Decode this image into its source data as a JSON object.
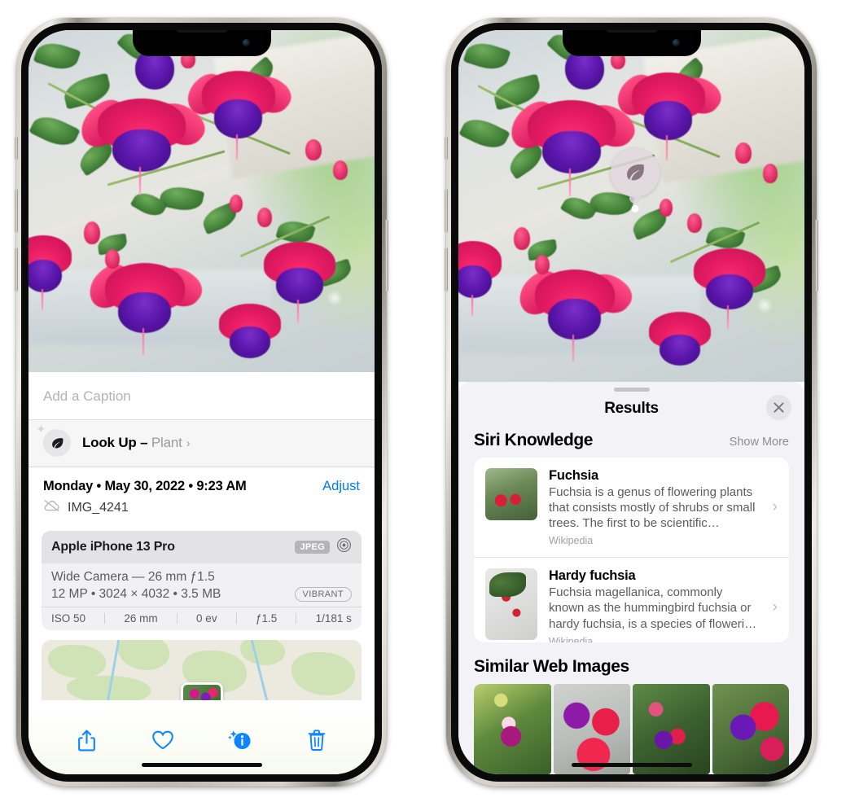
{
  "left_phone": {
    "name": "iPhone photo detail view",
    "photo": {
      "alt": "Fuchsia flowers hanging basket",
      "icon": "photo-icon"
    },
    "caption_field": {
      "placeholder": "Add a Caption",
      "value": ""
    },
    "lookup": {
      "icon": "leaf-icon",
      "sparkle_icon": "sparkle-icon",
      "label": "Look Up – ",
      "subject": "Plant",
      "chevron": "›"
    },
    "meta": {
      "date": "Monday • May 30, 2022 • 9:23 AM",
      "adjust_label": "Adjust",
      "cloud_icon": "cloud-slash-icon",
      "filename": "IMG_4241"
    },
    "camera_card": {
      "device": "Apple iPhone 13 Pro",
      "format_chip": "JPEG",
      "aperture_icon": "aperture-icon",
      "lens_line": "Wide Camera — 26 mm ƒ1.5",
      "specs_line": "12 MP • 3024 × 4032 • 3.5 MB",
      "style_chip": "VIBRANT",
      "exif": [
        "ISO 50",
        "26 mm",
        "0 ev",
        "ƒ1.5",
        "1/181 s"
      ]
    },
    "map": {
      "name": "location-map",
      "pin_label": ""
    },
    "toolbar": [
      {
        "name": "share-button",
        "icon": "share-icon"
      },
      {
        "name": "favorite-button",
        "icon": "heart-icon"
      },
      {
        "name": "info-button",
        "icon": "info-sparkle-icon"
      },
      {
        "name": "delete-button",
        "icon": "trash-icon"
      }
    ]
  },
  "right_phone": {
    "name": "Visual Look Up results view",
    "marker": {
      "icon": "leaf-icon",
      "label": ""
    },
    "sheet": {
      "grabber": "",
      "title": "Results",
      "close_icon": "close-icon"
    },
    "siri_knowledge": {
      "title": "Siri Knowledge",
      "show_more": "Show More",
      "items": [
        {
          "title": "Fuchsia",
          "description": "Fuchsia is a genus of flowering plants that consists mostly of shrubs or small trees. The first to be scientific…",
          "source": "Wikipedia",
          "thumb": "fuchsia-thumbnail",
          "chevron": "›"
        },
        {
          "title": "Hardy fuchsia",
          "description": "Fuchsia magellanica, commonly known as the hummingbird fuchsia or hardy fuchsia, is a species of floweri…",
          "source": "Wikipedia",
          "thumb": "hardy-fuchsia-thumbnail",
          "chevron": "›"
        }
      ]
    },
    "similar_web_images": {
      "title": "Similar Web Images",
      "tiles": [
        {
          "name": "web-image-1"
        },
        {
          "name": "web-image-2"
        },
        {
          "name": "web-image-3"
        },
        {
          "name": "web-image-4"
        }
      ]
    }
  },
  "colors": {
    "accent_blue": "#007aff",
    "sheet_gray": "#f2f2f7",
    "card_white": "#ffffff",
    "secondary_text": "#8e8e93"
  }
}
